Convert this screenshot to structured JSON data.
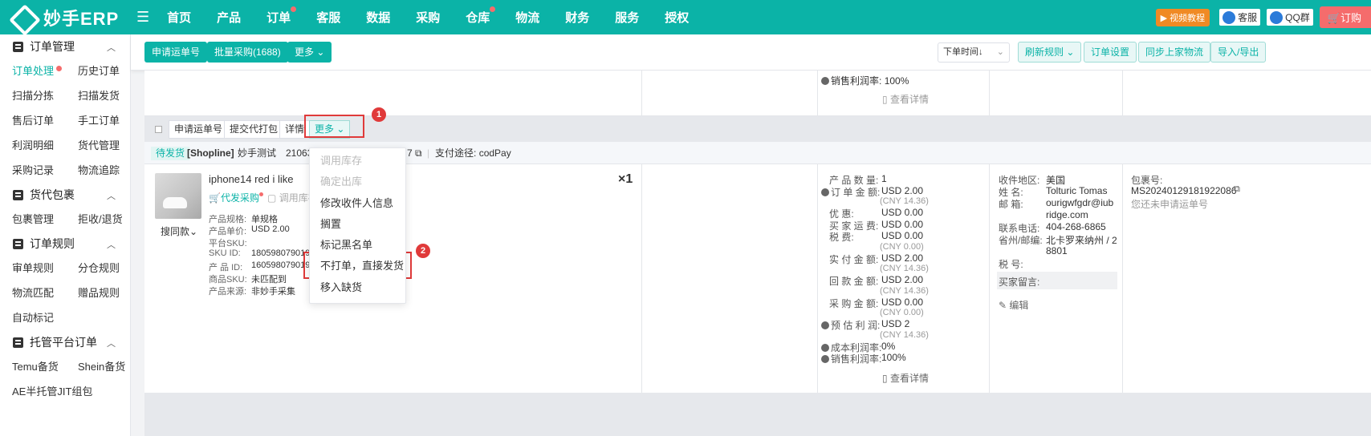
{
  "topbar": {
    "logo": "妙手ERP",
    "nav": [
      {
        "label": "首页",
        "dot": false
      },
      {
        "label": "产品",
        "dot": false
      },
      {
        "label": "订单",
        "dot": true
      },
      {
        "label": "客服",
        "dot": false
      },
      {
        "label": "数据",
        "dot": false
      },
      {
        "label": "采购",
        "dot": false
      },
      {
        "label": "仓库",
        "dot": true
      },
      {
        "label": "物流",
        "dot": false
      },
      {
        "label": "财务",
        "dot": false
      },
      {
        "label": "服务",
        "dot": false
      },
      {
        "label": "授权",
        "dot": false
      }
    ],
    "video": "视频教程",
    "service": "客服",
    "qq": "QQ群",
    "order": "订购"
  },
  "sidebar": {
    "sections": [
      {
        "title": "订单管理",
        "items": [
          "订单处理",
          "历史订单",
          "扫描分拣",
          "扫描发货",
          "售后订单",
          "手工订单",
          "利润明细",
          "货代管理",
          "采购记录",
          "物流追踪"
        ]
      },
      {
        "title": "货代包裹",
        "items": [
          "包裹管理",
          "拒收/退货"
        ]
      },
      {
        "title": "订单规则",
        "items": [
          "审单规则",
          "分仓规则",
          "物流匹配",
          "赠品规则",
          "自动标记"
        ]
      },
      {
        "title": "托管平台订单",
        "items": [
          "Temu备货",
          "Shein备货",
          "AE半托管JIT组包"
        ]
      }
    ]
  },
  "toolbar": {
    "apply_tracking": "申请运单号",
    "bulk_purchase": "批量采购(1688)",
    "more": "更多",
    "sort_select": "下单时间↓",
    "refresh_rules": "刷新规则",
    "order_settings": "订单设置",
    "sync_logistics": "同步上家物流",
    "import_export": "导入/导出"
  },
  "prev_order": {
    "margin_label": "销售利润率:",
    "margin_value": "100%",
    "details": "查看详情"
  },
  "actions": {
    "apply": "申请运单号",
    "submit": "提交代打包",
    "detail": "详情",
    "more": "更多",
    "badge1": "1",
    "badge2": "2"
  },
  "dropdown": [
    {
      "label": "调用库存",
      "disabled": true
    },
    {
      "label": "确定出库",
      "disabled": true
    },
    {
      "label": "修改收件人信息",
      "disabled": false
    },
    {
      "label": "搁置",
      "disabled": false
    },
    {
      "label": "标记黑名单",
      "disabled": false
    },
    {
      "label": "不打单，直接发货",
      "disabled": false
    },
    {
      "label": "移入缺货",
      "disabled": false
    }
  ],
  "order": {
    "status": "待发货",
    "shop": "[Shopline]",
    "shop_name": "妙手测试",
    "order_no_prefix": "210630",
    "order_no_suffix": "7",
    "payment_label": "支付途径:",
    "payment": "codPay",
    "product_name": "iphone14 red i like",
    "qty": "×1",
    "find_same": "搜同款",
    "dropship": "代发采购",
    "call_stock": "调用库存",
    "specs": [
      {
        "label": "产品规格:",
        "value": "单规格"
      },
      {
        "label": "产品单价:",
        "value": "USD 2.00"
      },
      {
        "label": "平台SKU:",
        "value": ""
      },
      {
        "label": "SKU  ID:",
        "value": "18059807901926"
      },
      {
        "label": "产 品 ID:",
        "value": "16059807901926"
      },
      {
        "label": "商品SKU:",
        "value": "未匹配到"
      },
      {
        "label": "产品来源:",
        "value": "非妙手采集"
      }
    ],
    "fees": [
      {
        "label": "产 品 数 量:",
        "value": "1",
        "cny": "",
        "q": false
      },
      {
        "label": "订 单 金 额:",
        "value": "USD 2.00",
        "cny": "(CNY 14.36)",
        "q": true
      },
      {
        "label": "优       惠:",
        "value": "USD 0.00",
        "cny": "",
        "q": false
      },
      {
        "label": "买 家 运 费:",
        "value": "USD 0.00",
        "cny": "",
        "q": false
      },
      {
        "label": "税       费:",
        "value": "USD 0.00",
        "cny": "(CNY 0.00)",
        "q": false
      },
      {
        "label": "实 付 金 额:",
        "value": "USD 2.00",
        "cny": "(CNY 14.36)",
        "q": false
      },
      {
        "label": "回 款 金 额:",
        "value": "USD 2.00",
        "cny": "(CNY 14.36)",
        "q": false
      },
      {
        "label": "采 购 金 额:",
        "value": "USD 0.00",
        "cny": "(CNY 0.00)",
        "q": false
      },
      {
        "label": "预 估 利 润:",
        "value": "USD 2",
        "cny": "(CNY 14.36)",
        "q": true
      },
      {
        "label": "成本利润率:",
        "value": "0%",
        "cny": "",
        "q": true
      },
      {
        "label": "销售利润率:",
        "value": "100%",
        "cny": "",
        "q": true
      }
    ],
    "details": "查看详情",
    "buyer": {
      "region_label": "收件地区:",
      "region": "美国",
      "name_label": "姓        名:",
      "name": "Tolturic Tomas",
      "email_label": "邮        箱:",
      "email1": "ourigwfgdr@iub",
      "email2": "ridge.com",
      "phone_label": "联系电话:",
      "phone": "404-268-6865",
      "state_label": "省州/邮编:",
      "state1": "北卡罗来纳州 / 2",
      "state2": "8801",
      "tax_label": "税        号:",
      "tax": "",
      "msg_label": "买家留言:",
      "edit": "编辑"
    },
    "package": {
      "label": "包裹号:",
      "number": "MS20240129181922086",
      "note": "您还未申请运单号"
    }
  }
}
